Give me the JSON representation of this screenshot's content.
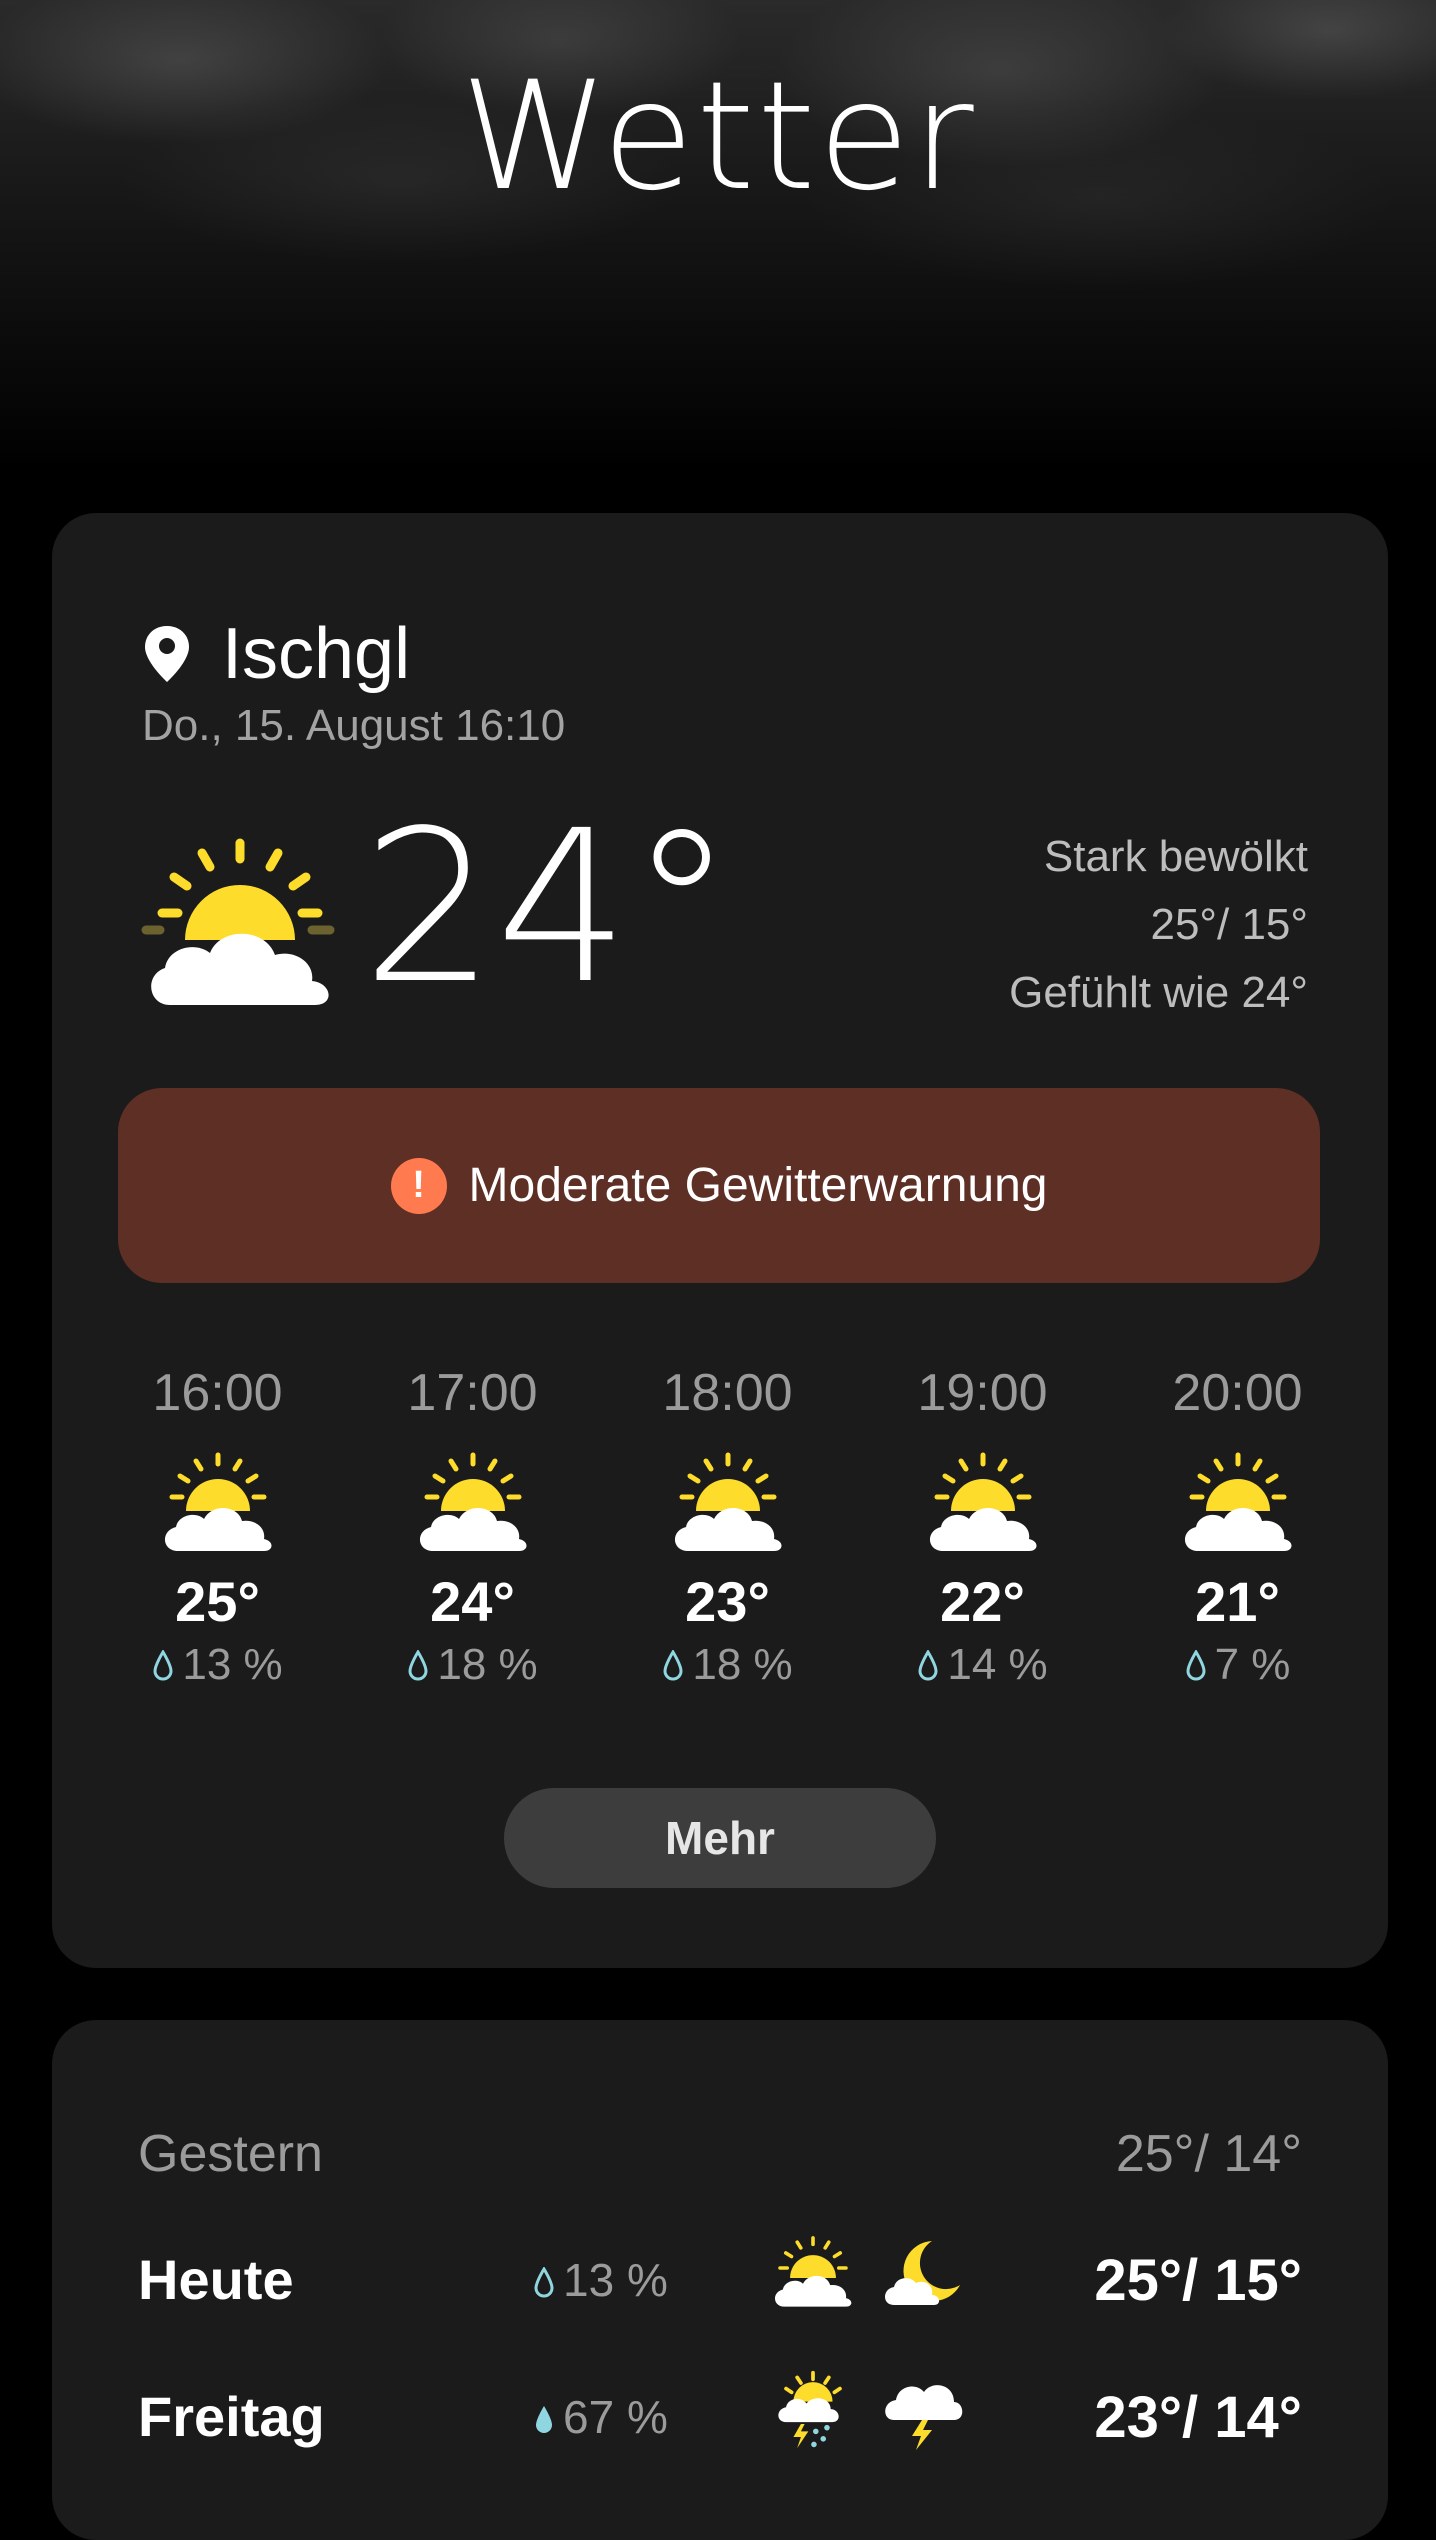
{
  "app": {
    "title": "Wetter"
  },
  "current": {
    "location": "Ischgl",
    "datetime": "Do., 15. August 16:10",
    "temperature": "24°",
    "condition": "Stark bewölkt",
    "high_low": "25°/ 15°",
    "feels_like": "Gefühlt wie 24°",
    "icon": "partly-cloudy-sun-icon"
  },
  "warning": {
    "icon": "exclamation-icon",
    "text": "Moderate Gewitterwarnung",
    "color": "#5e2f25"
  },
  "hourly": [
    {
      "time": "16:00",
      "temp": "25°",
      "precip": "13 %",
      "icon": "partly-cloudy-sun-icon"
    },
    {
      "time": "17:00",
      "temp": "24°",
      "precip": "18 %",
      "icon": "partly-cloudy-sun-icon"
    },
    {
      "time": "18:00",
      "temp": "23°",
      "precip": "18 %",
      "icon": "partly-cloudy-sun-icon"
    },
    {
      "time": "19:00",
      "temp": "22°",
      "precip": "14 %",
      "icon": "partly-cloudy-sun-icon"
    },
    {
      "time": "20:00",
      "temp": "21°",
      "precip": "7 %",
      "icon": "partly-cloudy-sun-icon"
    }
  ],
  "more_label": "Mehr",
  "daily": {
    "yesterday": {
      "label": "Gestern",
      "range": "25°/ 14°"
    },
    "rows": [
      {
        "day": "Heute",
        "precip": "13 %",
        "day_icon": "partly-cloudy-sun-icon",
        "night_icon": "cloudy-moon-icon",
        "range": "25°/ 15°"
      },
      {
        "day": "Freitag",
        "precip": "67 %",
        "day_icon": "sun-thunder-rain-icon",
        "night_icon": "thunder-cloud-icon",
        "range": "23°/ 14°"
      }
    ]
  },
  "colors": {
    "sun": "#fddc2b",
    "cloud": "#ffffff",
    "drop": "#8fd6e0",
    "warning_icon": "#ff7b4f",
    "card": "#1b1b1b"
  }
}
